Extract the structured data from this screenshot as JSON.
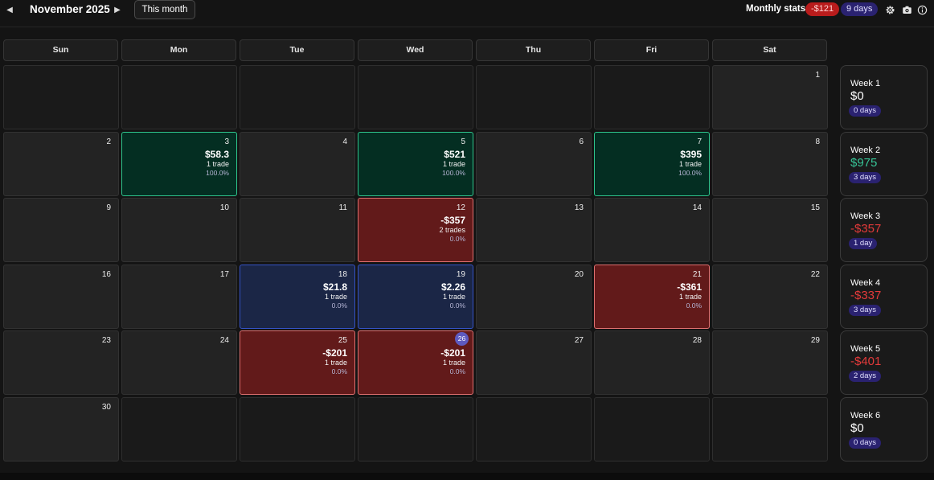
{
  "header": {
    "prev_icon": "chevron-left-icon",
    "prev_glyph": "◀",
    "month_title": "November 2025",
    "next_icon": "chevron-right-icon",
    "next_glyph": "▶",
    "this_month_label": "This month",
    "stats_label": "Monthly stats:",
    "stats_pnl": "-$121",
    "stats_days": "9 days",
    "tools": [
      "gear-icon",
      "camera-icon",
      "info-icon"
    ]
  },
  "weekdays": [
    "Sun",
    "Mon",
    "Tue",
    "Wed",
    "Thu",
    "Fri",
    "Sat"
  ],
  "days": [
    {
      "day": "",
      "state": "empty"
    },
    {
      "day": "",
      "state": "empty"
    },
    {
      "day": "",
      "state": "empty"
    },
    {
      "day": "",
      "state": "empty"
    },
    {
      "day": "",
      "state": "empty"
    },
    {
      "day": "",
      "state": "empty"
    },
    {
      "day": "1",
      "state": "plain"
    },
    {
      "day": "2",
      "state": "plain"
    },
    {
      "day": "3",
      "state": "win",
      "pnl": "$58.3",
      "trades": "1 trade",
      "pct": "100.0%"
    },
    {
      "day": "4",
      "state": "plain"
    },
    {
      "day": "5",
      "state": "win",
      "pnl": "$521",
      "trades": "1 trade",
      "pct": "100.0%"
    },
    {
      "day": "6",
      "state": "plain"
    },
    {
      "day": "7",
      "state": "win",
      "pnl": "$395",
      "trades": "1 trade",
      "pct": "100.0%"
    },
    {
      "day": "8",
      "state": "plain"
    },
    {
      "day": "9",
      "state": "plain"
    },
    {
      "day": "10",
      "state": "plain"
    },
    {
      "day": "11",
      "state": "plain"
    },
    {
      "day": "12",
      "state": "loss",
      "pnl": "-$357",
      "trades": "2 trades",
      "pct": "0.0%"
    },
    {
      "day": "13",
      "state": "plain"
    },
    {
      "day": "14",
      "state": "plain"
    },
    {
      "day": "15",
      "state": "plain"
    },
    {
      "day": "16",
      "state": "plain"
    },
    {
      "day": "17",
      "state": "plain"
    },
    {
      "day": "18",
      "state": "be",
      "pnl": "$21.8",
      "trades": "1 trade",
      "pct": "0.0%"
    },
    {
      "day": "19",
      "state": "be",
      "pnl": "$2.26",
      "trades": "1 trade",
      "pct": "0.0%"
    },
    {
      "day": "20",
      "state": "plain"
    },
    {
      "day": "21",
      "state": "loss",
      "pnl": "-$361",
      "trades": "1 trade",
      "pct": "0.0%"
    },
    {
      "day": "22",
      "state": "plain"
    },
    {
      "day": "23",
      "state": "plain"
    },
    {
      "day": "24",
      "state": "plain"
    },
    {
      "day": "25",
      "state": "loss",
      "pnl": "-$201",
      "trades": "1 trade",
      "pct": "0.0%"
    },
    {
      "day": "26",
      "state": "loss",
      "today": true,
      "pnl": "-$201",
      "trades": "1 trade",
      "pct": "0.0%"
    },
    {
      "day": "27",
      "state": "plain"
    },
    {
      "day": "28",
      "state": "plain"
    },
    {
      "day": "29",
      "state": "plain"
    },
    {
      "day": "30",
      "state": "plain"
    },
    {
      "day": "",
      "state": "empty"
    },
    {
      "day": "",
      "state": "empty"
    },
    {
      "day": "",
      "state": "empty"
    },
    {
      "day": "",
      "state": "empty"
    },
    {
      "day": "",
      "state": "empty"
    },
    {
      "day": "",
      "state": "empty"
    }
  ],
  "weeks": [
    {
      "label": "Week 1",
      "pnl": "$0",
      "days": "0 days",
      "tone": "neutral"
    },
    {
      "label": "Week 2",
      "pnl": "$975",
      "days": "3 days",
      "tone": "positive"
    },
    {
      "label": "Week 3",
      "pnl": "-$357",
      "days": "1 day",
      "tone": "negative"
    },
    {
      "label": "Week 4",
      "pnl": "-$337",
      "days": "3 days",
      "tone": "negative"
    },
    {
      "label": "Week 5",
      "pnl": "-$401",
      "days": "2 days",
      "tone": "negative"
    },
    {
      "label": "Week 6",
      "pnl": "$0",
      "days": "0 days",
      "tone": "neutral"
    }
  ],
  "colors": {
    "positive": "#37c597",
    "negative": "#e23a3a",
    "neutral": "#ffffff",
    "win_bg": "#042e22",
    "loss_bg": "#621a1a",
    "breakeven_bg": "#1b2646"
  }
}
